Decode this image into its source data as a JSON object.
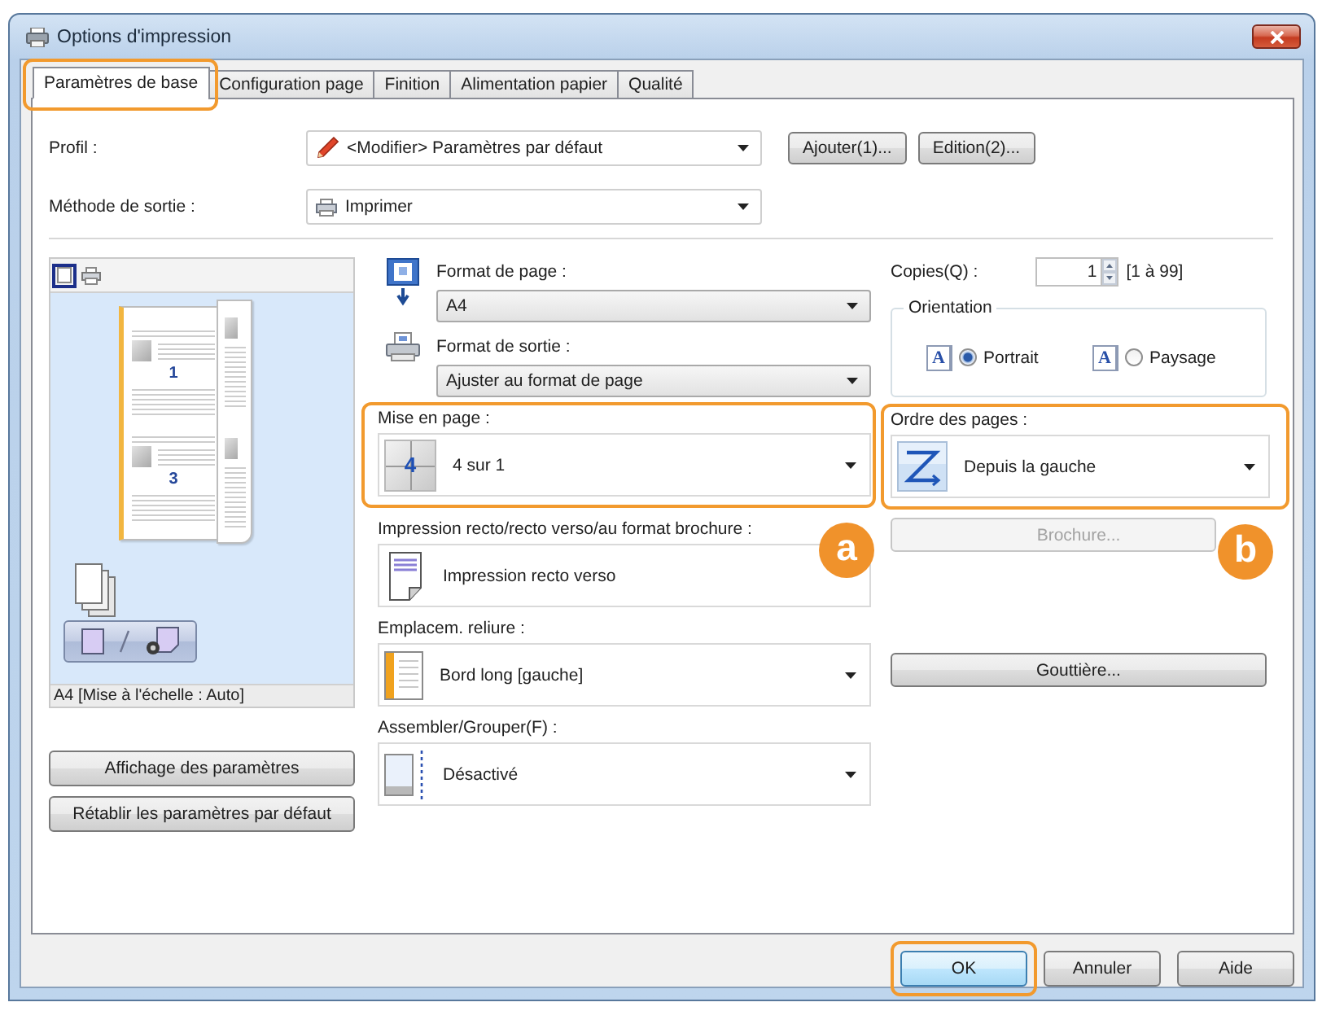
{
  "window": {
    "title": "Options d'impression"
  },
  "tabs": [
    {
      "label": "Paramètres de base",
      "selected": true,
      "highlighted": true
    },
    {
      "label": "Configuration page",
      "selected": false
    },
    {
      "label": "Finition",
      "selected": false
    },
    {
      "label": "Alimentation papier",
      "selected": false
    },
    {
      "label": "Qualité",
      "selected": false
    }
  ],
  "profile": {
    "label": "Profil :",
    "value": "<Modifier> Paramètres par défaut",
    "buttons": [
      "Ajouter(1)...",
      "Edition(2)..."
    ]
  },
  "output_method": {
    "label": "Méthode de sortie :",
    "value": "Imprimer"
  },
  "preview": {
    "view_modes": [
      {
        "kind": "page",
        "selected": true
      },
      {
        "kind": "printer",
        "selected": false
      }
    ],
    "page_numbers": [
      "1",
      "3"
    ],
    "caption": "A4 [Mise à l'échelle : Auto]"
  },
  "left_buttons": [
    "Affichage des paramètres",
    "Rétablir les paramètres par défaut"
  ],
  "paper_settings": [
    {
      "kind": "page",
      "label": "Format de page :",
      "value": "A4"
    },
    {
      "kind": "printer",
      "label": "Format de sortie :",
      "value": "Ajuster au format de page"
    }
  ],
  "layout_settings": [
    {
      "kind": "layout",
      "icon_text": "4",
      "label": "Mise en page :",
      "value": "4 sur 1",
      "dropdown": true,
      "highlighted": true,
      "callout": "a"
    },
    {
      "kind": "duplex",
      "label": "Impression recto/recto verso/au format brochure :",
      "value": "Impression recto verso",
      "dropdown": false
    },
    {
      "kind": "binding",
      "label": "Emplacem. reliure :",
      "value": "Bord long [gauche]",
      "dropdown": true
    },
    {
      "kind": "collate",
      "label": "Assembler/Grouper(F) :",
      "value": "Désactivé",
      "dropdown": true
    }
  ],
  "copies": {
    "label": "Copies(Q) :",
    "value": "1",
    "range": "[1 à 99]"
  },
  "orientation": {
    "legend": "Orientation",
    "options": [
      {
        "icon_text": "A",
        "label": "Portrait",
        "selected": true
      },
      {
        "icon_text": "A",
        "label": "Paysage",
        "selected": false
      }
    ]
  },
  "page_order": {
    "label": "Ordre des pages :",
    "value": "Depuis la gauche",
    "highlighted": true,
    "callout": "b"
  },
  "side_buttons": [
    {
      "label": "Brochure...",
      "disabled": true
    },
    {
      "label": "Gouttière...",
      "disabled": false
    }
  ],
  "footer_buttons": [
    {
      "label": "OK",
      "default": true,
      "highlighted": true
    },
    {
      "label": "Annuler",
      "default": false
    },
    {
      "label": "Aide",
      "default": false
    }
  ]
}
